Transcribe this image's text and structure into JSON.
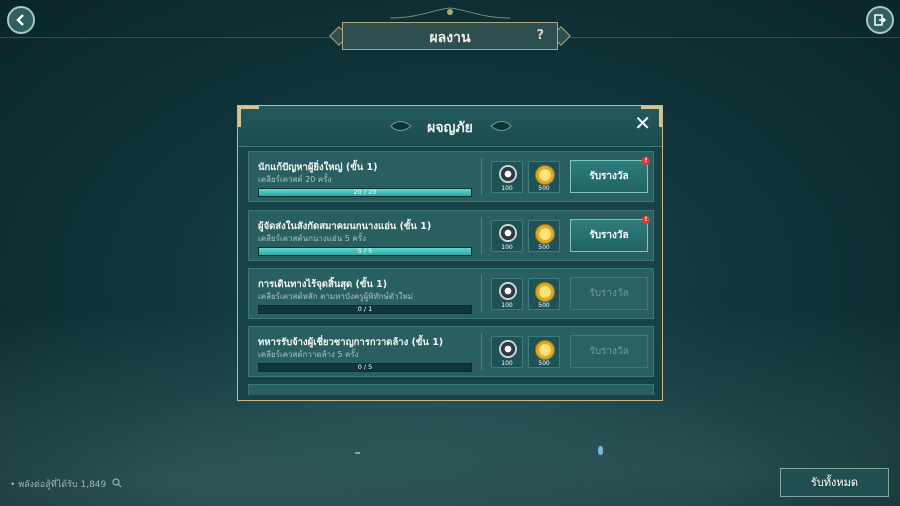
{
  "header": {
    "title": "ผลงาน",
    "help": "?"
  },
  "modal": {
    "title": "ผจญภัย",
    "close": "✕"
  },
  "rows": [
    {
      "name": "นักแก้ปัญหาผู้ยิ่งใหญ่ (ขั้น 1)",
      "desc": "เคลียร์เควสต์ 20 ครั้ง",
      "progress_text": "20 / 20",
      "progress": 1.0,
      "reward1": "100",
      "reward2": "500",
      "button": "รับรางวัล",
      "claimable": true,
      "alert": "!"
    },
    {
      "name": "ผู้จัดส่งในสังกัดสมาคมนกนางแอ่น (ขั้น 1)",
      "desc": "เคลียร์เควสต์นกนางแอ่น 5 ครั้ง",
      "progress_text": "5 / 5",
      "progress": 1.0,
      "reward1": "100",
      "reward2": "500",
      "button": "รับรางวัล",
      "claimable": true,
      "alert": "!"
    },
    {
      "name": "การเดินทางไร้จุดสิ้นสุด (ขั้น 1)",
      "desc": "เคลียร์เควสต์หลัก ตามหาบังครูผู้พิทักษ์ตัวใหม่",
      "progress_text": "0 / 1",
      "progress": 0,
      "reward1": "100",
      "reward2": "500",
      "button": "รับรางวัล",
      "claimable": false,
      "alert": ""
    },
    {
      "name": "ทหารรับจ้างผู้เชี่ยวชาญการกวาดล้าง (ขั้น 1)",
      "desc": "เคลียร์เควสต์กวาดล้าง 5 ครั้ง",
      "progress_text": "0 / 5",
      "progress": 0,
      "reward1": "100",
      "reward2": "500",
      "button": "รับรางวัล",
      "claimable": false,
      "alert": ""
    }
  ],
  "footer": {
    "power_text": "พลังต่อสู้ที่ได้รับ 1,849",
    "claim_all": "รับทั้งหมด"
  },
  "colors": {
    "accent": "#2ba9a6",
    "gold": "#c9b987",
    "alert": "#e23a3a"
  }
}
